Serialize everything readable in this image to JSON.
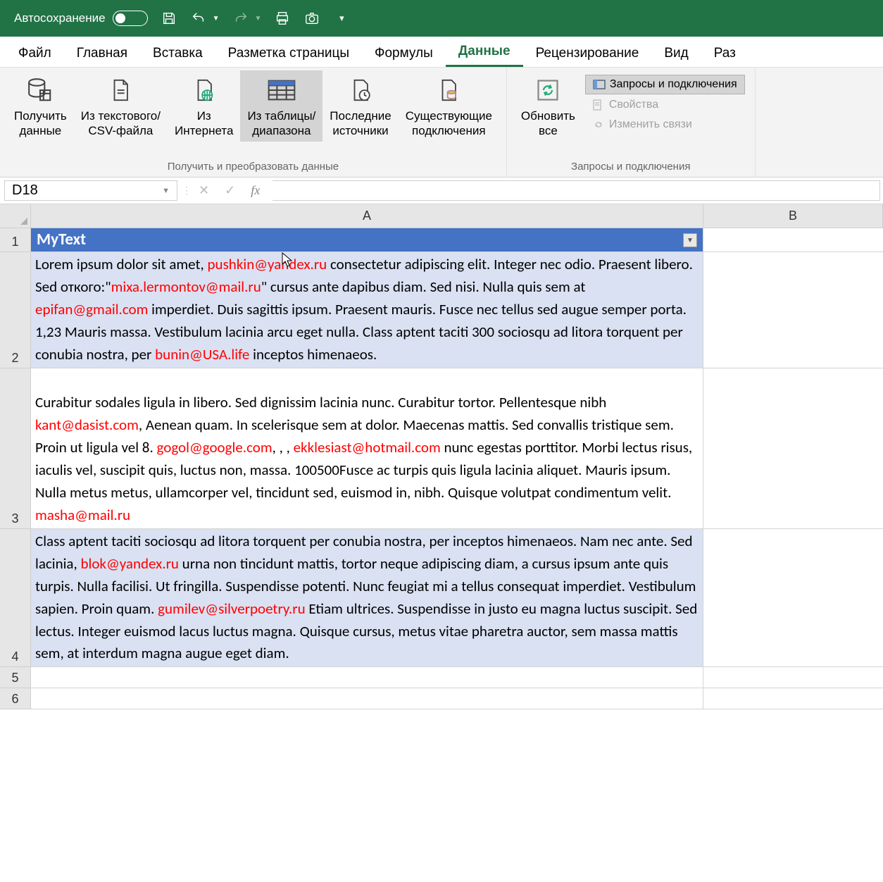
{
  "titlebar": {
    "autosave_label": "Автосохранение"
  },
  "tabs": {
    "file": "Файл",
    "home": "Главная",
    "insert": "Вставка",
    "page_layout": "Разметка страницы",
    "formulas": "Формулы",
    "data": "Данные",
    "review": "Рецензирование",
    "view": "Вид",
    "dev": "Раз"
  },
  "ribbon": {
    "group1_label": "Получить и преобразовать данные",
    "group2_label": "Запросы и подключения",
    "get_data": "Получить\nданные",
    "from_csv": "Из текстового/\nCSV-файла",
    "from_web": "Из\nИнтернета",
    "from_table": "Из таблицы/\nдиапазона",
    "recent": "Последние\nисточники",
    "existing": "Существующие\nподключения",
    "refresh": "Обновить\nвсе",
    "queries": "Запросы и подключения",
    "properties": "Свойства",
    "links": "Изменить связи"
  },
  "formula_bar": {
    "name_box": "D18",
    "formula": ""
  },
  "columns": {
    "A": "A",
    "B": "B"
  },
  "table": {
    "header": "MyText",
    "rows": [
      {
        "num": "1"
      },
      {
        "num": "2",
        "segments": [
          {
            "t": "Lorem ipsum dolor sit amet, "
          },
          {
            "t": "pushkin@yandex.ru",
            "e": true
          },
          {
            "t": " consectetur adipiscing elit. Integer nec odio. Praesent libero. Sed откого:\""
          },
          {
            "t": "mixa.lermontov@mail.ru",
            "e": true
          },
          {
            "t": "\" cursus ante dapibus diam. Sed nisi. Nulla quis sem at "
          },
          {
            "t": "epifan@gmail.com",
            "e": true
          },
          {
            "t": " imperdiet. Duis sagittis ipsum. Praesent mauris. Fusce nec tellus sed augue semper porta. 1,23 Mauris massa. Vestibulum lacinia arcu eget nulla. Class aptent taciti 300 sociosqu ad litora torquent per conubia nostra, per  "
          },
          {
            "t": "bunin@USA.life",
            "e": true
          },
          {
            "t": " inceptos himenaeos."
          }
        ]
      },
      {
        "num": "3",
        "leading_blank": true,
        "segments": [
          {
            "t": "Curabitur sodales ligula in libero. Sed dignissim lacinia nunc. Curabitur tortor. Pellentesque nibh "
          },
          {
            "t": "kant@dasist.com",
            "e": true
          },
          {
            "t": ", Aenean quam. In scelerisque sem at dolor. Maecenas mattis. Sed convallis tristique sem. Proin ut ligula vel 8. "
          },
          {
            "t": "gogol@google.com",
            "e": true
          },
          {
            "t": ", , , "
          },
          {
            "t": "ekklesiast@hotmail.com",
            "e": true
          },
          {
            "t": " nunc egestas porttitor. Morbi lectus risus, iaculis vel, suscipit quis, luctus non, massa. 100500Fusce ac turpis quis ligula lacinia aliquet. Mauris ipsum. Nulla metus metus, ullamcorper vel, tincidunt sed, euismod in, nibh. Quisque volutpat condimentum velit. "
          },
          {
            "t": "masha@mail.ru",
            "e": true
          }
        ]
      },
      {
        "num": "4",
        "segments": [
          {
            "t": "Class aptent taciti sociosqu ad litora torquent per conubia nostra, per inceptos himenaeos. Nam nec ante. Sed lacinia, "
          },
          {
            "t": "blok@yandex.ru",
            "e": true
          },
          {
            "t": " urna non tincidunt mattis, tortor neque adipiscing diam, a cursus ipsum ante quis turpis. Nulla facilisi. Ut fringilla. Suspendisse potenti. Nunc feugiat mi a tellus consequat imperdiet. Vestibulum sapien. Proin quam. "
          },
          {
            "t": "gumilev@silverpoetry.ru",
            "e": true
          },
          {
            "t": " Etiam ultrices. Suspendisse in justo eu magna luctus suscipit. Sed lectus. Integer euismod lacus luctus magna. Quisque cursus, metus vitae pharetra auctor, sem massa mattis sem, at interdum magna augue eget diam."
          }
        ]
      },
      {
        "num": "5"
      },
      {
        "num": "6"
      }
    ]
  }
}
